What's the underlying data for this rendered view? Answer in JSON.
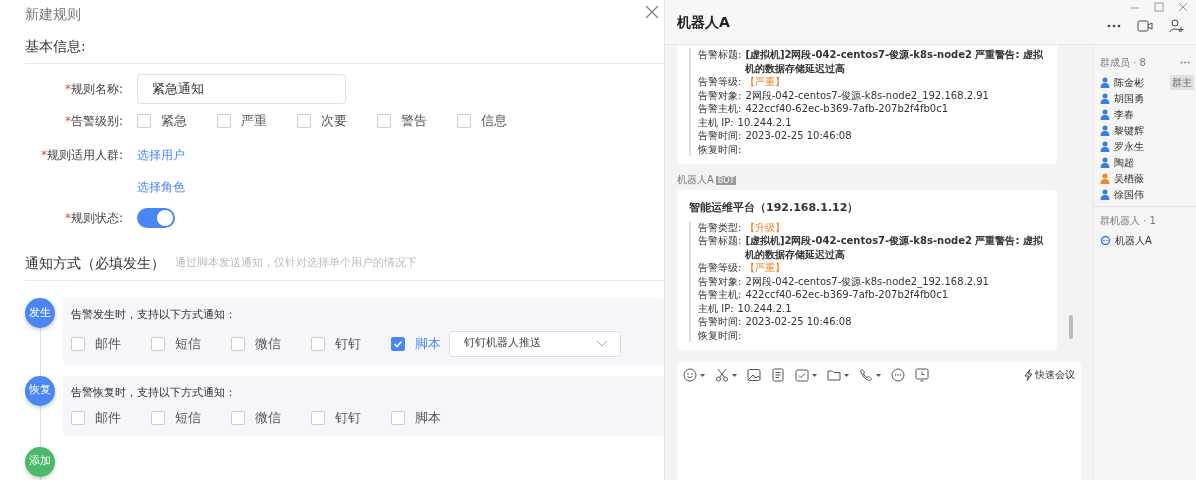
{
  "dialog": {
    "title": "新建规则"
  },
  "basic": {
    "title": "基本信息:"
  },
  "fields": [
    {
      "kind": "text",
      "required_mark": "*",
      "label": "规则名称:",
      "value": "紧急通知"
    },
    {
      "kind": "checkboxes",
      "required_mark": "*",
      "label": "告警级别:",
      "options": [
        {
          "label": "紧急",
          "checked": false
        },
        {
          "label": "严重",
          "checked": false
        },
        {
          "label": "次要",
          "checked": false
        },
        {
          "label": "警告",
          "checked": false
        },
        {
          "label": "信息",
          "checked": false
        }
      ]
    },
    {
      "kind": "links",
      "required_mark": "*",
      "label": "规则适用人群:",
      "links": [
        "选择用户",
        "选择角色"
      ]
    },
    {
      "kind": "switch",
      "required_mark": "*",
      "label": "规则状态:",
      "on": true
    }
  ],
  "notify": {
    "title": "通知方式（必填发生）",
    "hint": "通过脚本发送通知，仅针对选择单个用户的情况下",
    "stages": [
      {
        "badge": "发生",
        "color": "#4b86f5",
        "prompt": "告警发生时，支持以下方式通知：",
        "options": [
          {
            "label": "邮件",
            "checked": false
          },
          {
            "label": "短信",
            "checked": false
          },
          {
            "label": "微信",
            "checked": false
          },
          {
            "label": "钉钉",
            "checked": false
          },
          {
            "label": "脚本",
            "checked": true
          }
        ],
        "select": {
          "value": "钉钉机器人推送"
        }
      },
      {
        "badge": "恢复",
        "color": "#4b86f5",
        "prompt": "告警恢复时，支持以下方式通知：",
        "options": [
          {
            "label": "邮件",
            "checked": false
          },
          {
            "label": "短信",
            "checked": false
          },
          {
            "label": "微信",
            "checked": false
          },
          {
            "label": "钉钉",
            "checked": false
          },
          {
            "label": "脚本",
            "checked": false
          }
        ]
      }
    ],
    "add_button": {
      "label": "添加",
      "color": "#4cba6a"
    }
  },
  "chat": {
    "title": "机器人A",
    "messages": [
      {
        "lines": [
          {
            "kind": "bold",
            "label": "告警标题:",
            "value": "[虚拟机]2网段-042-centos7-俊源-k8s-node2 严重警告: 虚拟机的数据存储延迟过高"
          },
          {
            "kind": "tag",
            "label": "告警等级:",
            "value": "【严重】"
          },
          {
            "kind": "plain",
            "label": "告警对象:",
            "value": "2网段-042-centos7-俊源-k8s-node2_192.168.2.91"
          },
          {
            "kind": "plain",
            "label": "告警主机:",
            "value": "422ccf40-62ec-b369-7afb-207b2f4fb0c1"
          },
          {
            "kind": "plain",
            "label": "主机  IP:",
            "value": "10.244.2.1"
          },
          {
            "kind": "plain",
            "label": "告警时间:",
            "value": "2023-02-25 10:46:08"
          },
          {
            "kind": "plain",
            "label": "恢复时间:"
          }
        ]
      },
      {
        "sender": "机器人A",
        "sender_badge": "BOT",
        "heading": "智能运维平台（192.168.1.12）",
        "lines": [
          {
            "kind": "tag",
            "label": "告警类型:",
            "value": "【升级】"
          },
          {
            "kind": "bold",
            "label": "告警标题:",
            "value": "[虚拟机]2网段-042-centos7-俊源-k8s-node2 严重警告: 虚拟机的数据存储延迟过高"
          },
          {
            "kind": "tag",
            "label": "告警等级:",
            "value": "【严重】"
          },
          {
            "kind": "plain",
            "label": "告警对象:",
            "value": "2网段-042-centos7-俊源-k8s-node2_192.168.2.91"
          },
          {
            "kind": "plain",
            "label": "告警主机:",
            "value": "422ccf40-62ec-b369-7afb-207b2f4fb0c1"
          },
          {
            "kind": "plain",
            "label": "主机  IP:",
            "value": "10.244.2.1"
          },
          {
            "kind": "plain",
            "label": "告警时间:",
            "value": "2023-02-25 10:46:08"
          },
          {
            "kind": "plain",
            "label": "恢复时间:"
          }
        ]
      }
    ],
    "composer": {
      "meeting_button": "快速会议"
    },
    "members_title": "群成员 · 8",
    "members": [
      {
        "name": "陈金彬",
        "role_badge": "群主",
        "color": "#3a7de0"
      },
      {
        "name": "胡国勇",
        "color": "#3a7de0"
      },
      {
        "name": "李春",
        "color": "#3a7de0"
      },
      {
        "name": "黎键辉",
        "color": "#3a7de0"
      },
      {
        "name": "罗永生",
        "color": "#3a7de0"
      },
      {
        "name": "陶超",
        "color": "#3a7de0"
      },
      {
        "name": "吴楢薇",
        "color": "#f0862a"
      },
      {
        "name": "徐国伟",
        "color": "#3a7de0"
      }
    ],
    "bots_title": "群机器人 · 1",
    "bots": [
      {
        "name": "机器人A"
      }
    ]
  }
}
